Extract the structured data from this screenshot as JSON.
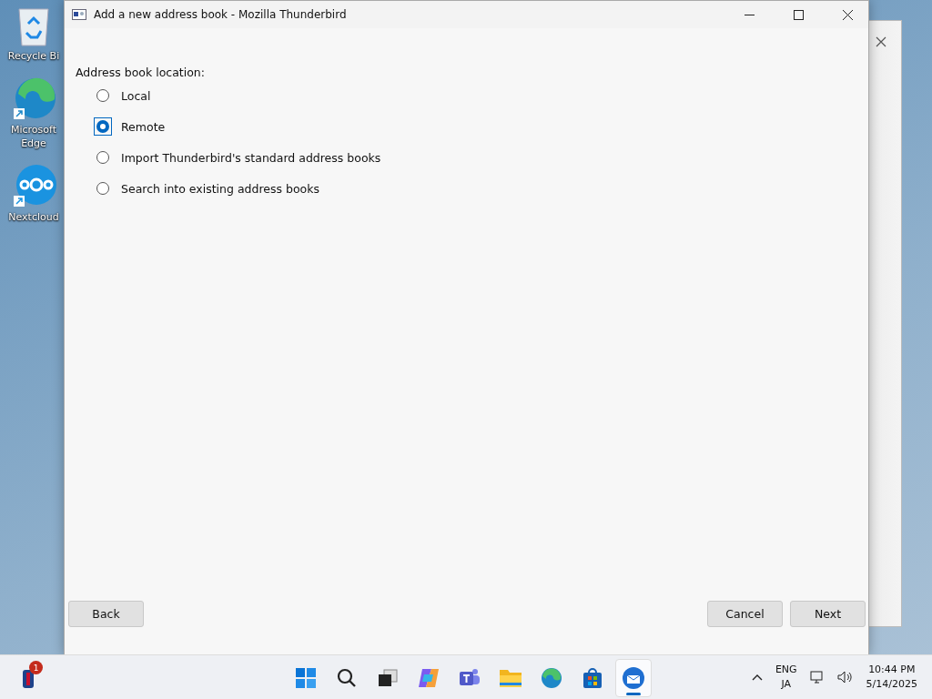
{
  "desktop_icons": [
    {
      "kind": "recycle",
      "label": "Recycle Bi"
    },
    {
      "kind": "edge",
      "label": "Microsoft Edge"
    },
    {
      "kind": "nextcloud",
      "label": "Nextcloud"
    }
  ],
  "dialog": {
    "title": "Add a new address book - Mozilla Thunderbird",
    "section_label": "Address book location:",
    "options": [
      {
        "label": "Local",
        "selected": false
      },
      {
        "label": "Remote",
        "selected": true
      },
      {
        "label": "Import Thunderbird's standard address books",
        "selected": false
      },
      {
        "label": "Search into existing address books",
        "selected": false
      }
    ],
    "buttons": [
      {
        "kind": "back",
        "label": "Back"
      },
      {
        "kind": "cancel",
        "label": "Cancel"
      },
      {
        "kind": "next",
        "label": "Next"
      }
    ]
  },
  "taskbar": {
    "widget_badge": "1",
    "apps": [
      {
        "kind": "start",
        "selected": false
      },
      {
        "kind": "search",
        "selected": false
      },
      {
        "kind": "taskview",
        "selected": false
      },
      {
        "kind": "copilot",
        "selected": false
      },
      {
        "kind": "teams",
        "selected": false
      },
      {
        "kind": "files",
        "selected": false
      },
      {
        "kind": "edge",
        "selected": false
      },
      {
        "kind": "store",
        "selected": false
      },
      {
        "kind": "thunderbird",
        "selected": true
      }
    ],
    "language": "ENG",
    "input_mode": "JA",
    "time": "10:44 PM",
    "date": "5/14/2025"
  }
}
